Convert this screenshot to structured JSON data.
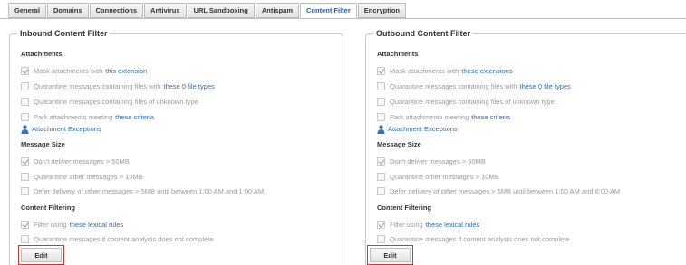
{
  "tabs": [
    "General",
    "Domains",
    "Connections",
    "Antivirus",
    "URL Sandboxing",
    "Antispam",
    "Content Filter",
    "Encryption"
  ],
  "active_tab": "Content Filter",
  "inbound": {
    "title": "Inbound Content Filter",
    "attachments_header": "Attachments",
    "mask_text": "Mask attachments with",
    "mask_link": "this extension",
    "quar_types_text": "Quarantine messages containing files with",
    "quar_types_link": "these 0 file types",
    "quar_unknown": "Quarantine messages containing files of unknown type",
    "park_text": "Park attachments meeting",
    "park_link": "these criteria",
    "exceptions_link": "Attachment Exceptions",
    "size_header": "Message Size",
    "dont_deliver": "Don't deliver messages > 50MB",
    "quar_other": "Quarantine other messages > 10MB",
    "defer": "Defer delivery of other messages > 5MB until between 1:00 AM and 1:00 AM",
    "filtering_header": "Content Filtering",
    "filter_text": "Filter using",
    "filter_link": "these lexical rules",
    "quar_analysis": "Quarantine messages if content analysis does not complete",
    "edit_label": "Edit"
  },
  "outbound": {
    "title": "Outbound Content Filter",
    "attachments_header": "Attachments",
    "mask_text": "Mask attachments with",
    "mask_link": "these extensions",
    "quar_types_text": "Quarantine messages containing files with",
    "quar_types_link": "these 0 file types",
    "quar_unknown": "Quarantine messages containing files of unknown type",
    "park_text": "Park attachments meeting",
    "park_link": "these criteria",
    "exceptions_link": "Attachment Exceptions",
    "size_header": "Message Size",
    "dont_deliver": "Don't deliver messages > 50MB",
    "quar_other": "Quarantine other messages > 10MB",
    "defer": "Defer delivery of other messages > 5MB until between 1:00 AM and 6:00 AM",
    "filtering_header": "Content Filtering",
    "filter_text": "Filter using",
    "filter_link": "these lexical rules",
    "quar_analysis": "Quarantine messages if content analysis does not complete",
    "edit_label": "Edit"
  },
  "icons": {
    "exceptions": "attachment-exceptions-icon"
  },
  "colors": {
    "link": "#2a6fc0",
    "active_tab_text": "#1a5fa8",
    "highlight_border": "#e0322d"
  }
}
